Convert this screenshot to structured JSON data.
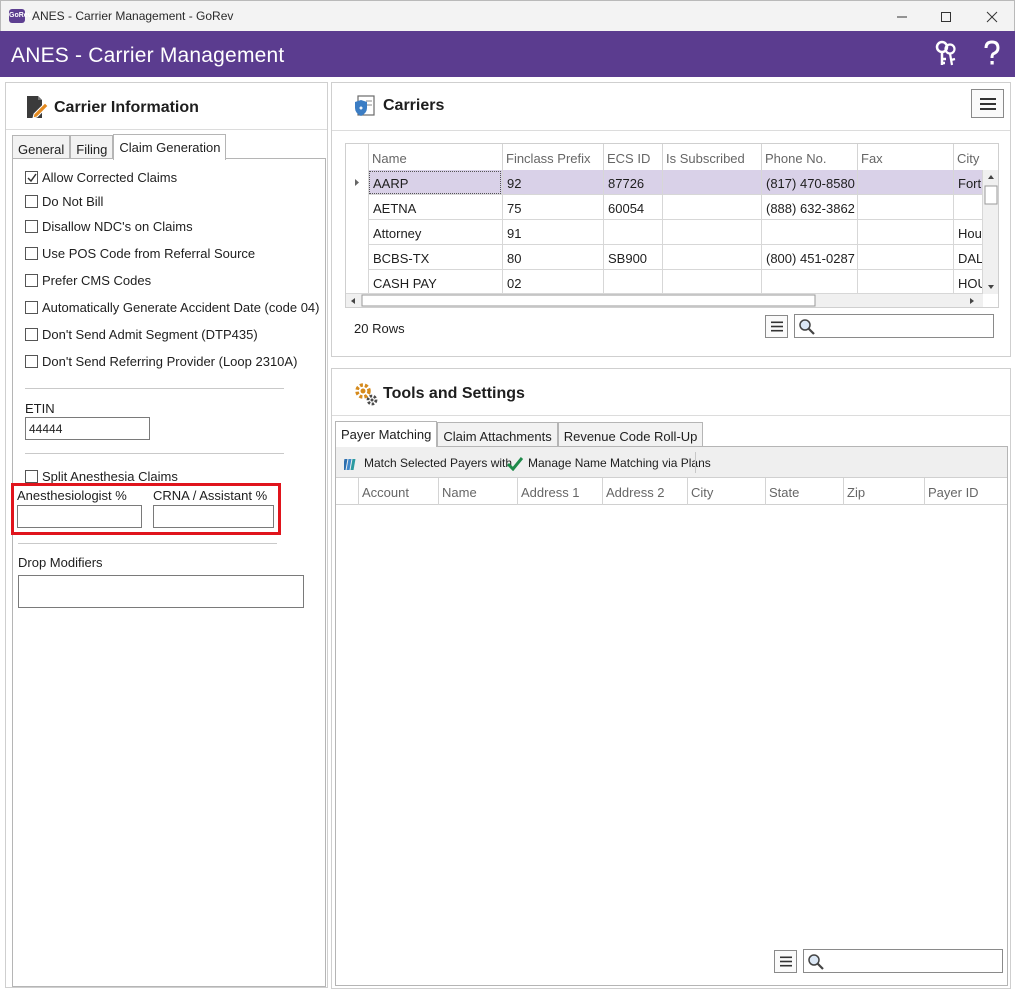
{
  "window": {
    "title": "ANES - Carrier Management - GoRev",
    "app_icon": "GoRev"
  },
  "header": {
    "title": "ANES - Carrier Management"
  },
  "carrier_info": {
    "title": "Carrier Information",
    "tabs": [
      "General",
      "Filing",
      "Claim Generation"
    ],
    "active_tab": "Claim Generation",
    "checkboxes": [
      {
        "label": "Allow Corrected Claims",
        "checked": true
      },
      {
        "label": "Do Not Bill",
        "checked": false
      },
      {
        "label": "Disallow NDC's on Claims",
        "checked": false
      },
      {
        "label": "Use POS Code from Referral Source",
        "checked": false
      },
      {
        "label": "Prefer CMS Codes",
        "checked": false
      },
      {
        "label": "Automatically Generate Accident Date (code 04)",
        "checked": false
      },
      {
        "label": "Don't Send Admit Segment (DTP435)",
        "checked": false
      },
      {
        "label": "Don't Send Referring Provider (Loop 2310A)",
        "checked": false
      }
    ],
    "etin_label": "ETIN",
    "etin_value": "44444",
    "split_anesthesia_label": "Split Anesthesia Claims",
    "split_anesthesia_checked": false,
    "anesthesiologist_label": "Anesthesiologist %",
    "anesthesiologist_value": "",
    "crna_label": "CRNA / Assistant %",
    "crna_value": "",
    "drop_modifiers_label": "Drop Modifiers",
    "drop_modifiers_value": ""
  },
  "carriers": {
    "title": "Carriers",
    "columns": [
      "Name",
      "Finclass Prefix",
      "ECS ID",
      "Is Subscribed",
      "Phone No.",
      "Fax",
      "City"
    ],
    "rows": [
      [
        "AARP",
        "92",
        "87726",
        "",
        "(817) 470-8580",
        "",
        "Fort"
      ],
      [
        "AETNA",
        "75",
        "60054",
        "",
        "(888) 632-3862",
        "",
        ""
      ],
      [
        "Attorney",
        "91",
        "",
        "",
        "",
        "",
        "Hou"
      ],
      [
        "BCBS-TX",
        "80",
        "SB900",
        "",
        "(800) 451-0287",
        "",
        "DAL"
      ],
      [
        "CASH PAY",
        "02",
        "",
        "",
        "",
        "",
        "HOU"
      ]
    ],
    "selected_row": 0,
    "row_count": "20 Rows",
    "search_value": ""
  },
  "tools": {
    "title": "Tools and Settings",
    "tabs": [
      "Payer Matching",
      "Claim Attachments",
      "Revenue Code Roll-Up"
    ],
    "active_tab": "Payer Matching",
    "toolbar": {
      "match_label": "Match Selected Payers with",
      "manage_label": "Manage Name Matching via Plans"
    },
    "columns": [
      "Account",
      "Name",
      "Address 1",
      "Address 2",
      "City",
      "State",
      "Zip",
      "Payer ID"
    ],
    "search_value": ""
  },
  "colors": {
    "header_purple": "#5b3c8f",
    "selection": "#d9d1e8",
    "highlight_red": "#e0141c"
  }
}
